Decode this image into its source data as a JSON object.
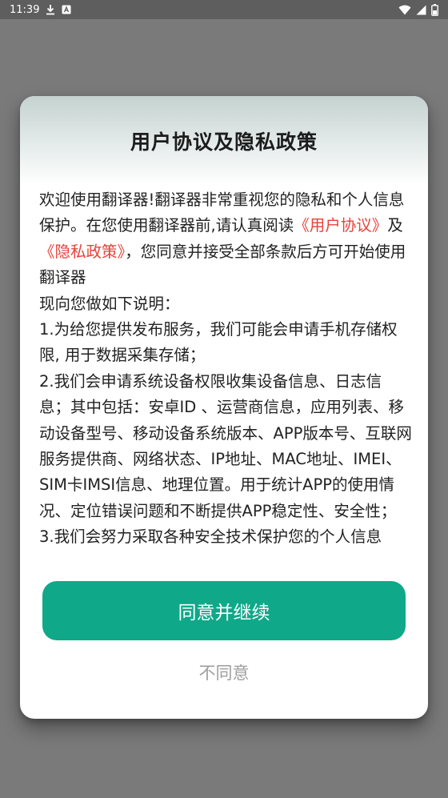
{
  "status_bar": {
    "time": "11:39",
    "icons": [
      "download-icon",
      "a-notification-icon",
      "wifi-icon",
      "cell-signal-icon",
      "battery-icon"
    ]
  },
  "dialog": {
    "title": "用户协议及隐私政策",
    "intro_part1": "欢迎使用翻译器!翻译器非常重视您的隐私和个人信息保护。在您使用翻译器前,请认真阅读",
    "user_agreement_link": "《用户协议》",
    "and": "及",
    "privacy_policy_link": "《隐私政策》",
    "intro_part2": "，您同意并接受全部条款后方可开始使用翻译器",
    "explain_heading": "现向您做如下说明：",
    "item1": "1.为给您提供发布服务，我们可能会申请手机存储权限, 用于数据采集存储；",
    "item2": "2.我们会申请系统设备权限收集设备信息、日志信息；其中包括：安卓ID 、运营商信息，应用列表、移动设备型号、移动设备系统版本、APP版本号、互联网服务提供商、网络状态、IP地址、MAC地址、IMEI、SIM卡IMSI信息、地理位置。用于统计APP的使用情况、定位错误问题和不断提供APP稳定性、安全性；",
    "item3_partial": "3.我们会努力采取各种安全技术保护您的个人信息",
    "agree_button": "同意并继续",
    "disagree_button": "不同意"
  },
  "colors": {
    "accent": "#0fa889",
    "link": "#e8413b",
    "overlay": "#7a7a7a"
  }
}
